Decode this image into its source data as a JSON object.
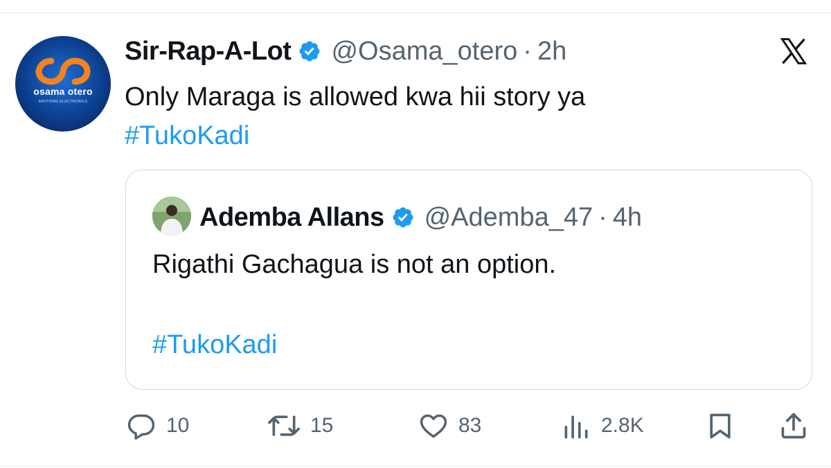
{
  "tweet": {
    "display_name": "Sir-Rap-A-Lot",
    "handle": "@Osama_otero",
    "separator": "·",
    "time": "2h",
    "text": "Only Maraga is allowed kwa hii story ya",
    "hashtag": "#TukoKadi",
    "avatar_text": "osama otero",
    "avatar_subtext": "ANYTHING ELECTRONICS",
    "verified_icon": "verified-badge-icon",
    "platform_icon": "x-logo-icon"
  },
  "quote": {
    "display_name": "Ademba Allans",
    "handle": "@Ademba_47",
    "separator": "·",
    "time": "4h",
    "text": "Rigathi Gachagua is not an option.",
    "hashtag": "#TukoKadi"
  },
  "actions": {
    "replies": "10",
    "reposts": "15",
    "likes": "83",
    "views": "2.8K"
  },
  "colors": {
    "accent": "#1d9bf0",
    "text": "#0f1419",
    "muted": "#536471",
    "border": "#cfd9de",
    "avatar_orange": "#f5821f"
  }
}
